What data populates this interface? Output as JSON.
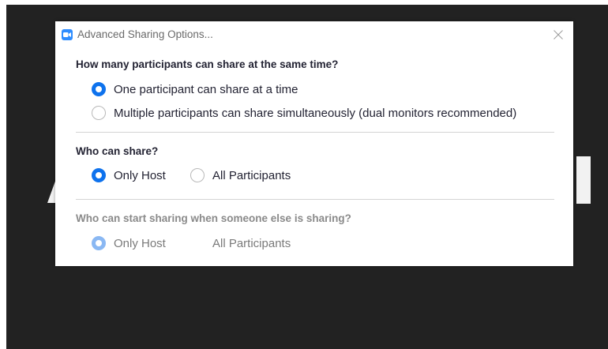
{
  "dialog": {
    "title": "Advanced Sharing Options..."
  },
  "colors": {
    "accent": "#0e72ed",
    "zoom_icon": "#2d8cff"
  },
  "icons": {
    "app": "zoom-app-icon",
    "close": "close-icon"
  },
  "sections": [
    {
      "heading": "How many participants can share at the same time?",
      "options": [
        {
          "label": "One participant can share at a time",
          "selected": true
        },
        {
          "label": "Multiple participants can share simultaneously (dual monitors recommended)",
          "selected": false
        }
      ]
    },
    {
      "heading": "Who can share?",
      "options": [
        {
          "label": "Only Host",
          "selected": true
        },
        {
          "label": "All Participants",
          "selected": false
        }
      ]
    },
    {
      "heading": "Who can start sharing when someone else is sharing?",
      "disabled": true,
      "options": [
        {
          "label": "Only Host",
          "selected": true
        },
        {
          "label": "All Participants",
          "selected": false
        }
      ]
    }
  ]
}
